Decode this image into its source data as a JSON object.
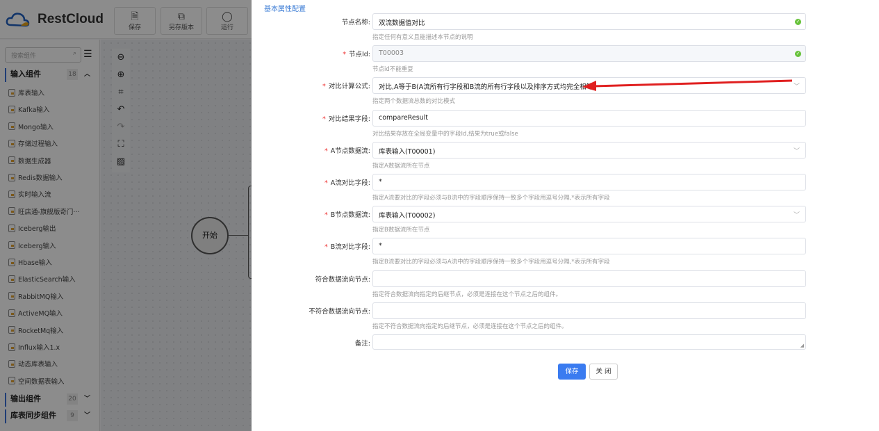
{
  "app": {
    "brand": "RestCloud",
    "toolbar": [
      {
        "label": "保存",
        "icon": "save-icon"
      },
      {
        "label": "另存版本",
        "icon": "save-version-icon"
      },
      {
        "label": "运行",
        "icon": "run-icon"
      }
    ]
  },
  "sidebar": {
    "search_placeholder": "搜索组件",
    "groups": [
      {
        "label": "输入组件",
        "count": "18",
        "expanded": true
      },
      {
        "label": "输出组件",
        "count": "20"
      },
      {
        "label": "库表同步组件",
        "count": "9"
      }
    ],
    "items": [
      "库表输入",
      "Kafka输入",
      "Mongo输入",
      "存储过程输入",
      "数据生成器",
      "Redis数据输入",
      "实时输入流",
      "旺店通-旗舰版奇门···",
      "Iceberg输出",
      "Iceberg输入",
      "Hbase输入",
      "ElasticSearch输入",
      "RabbitMQ输入",
      "ActiveMQ输入",
      "RocketMq输入",
      "Influx输入1.x",
      "动态库表输入",
      "空间数据表输入"
    ]
  },
  "canvas": {
    "start_node": "开始"
  },
  "form": {
    "section_title": "基本属性配置",
    "fields": [
      {
        "label": "节点名称:",
        "value": "双流数据值对比",
        "hint": "指定任何有意义且能描述本节点的说明",
        "required": false
      },
      {
        "label": "节点Id:",
        "value": "T00003",
        "hint": "节点id不能重复",
        "required": true
      },
      {
        "label": "对比计算公式:",
        "value": "对比,A等于B(A流所有行字段和B流的所有行字段以及排序方式均完全相等)",
        "hint": "指定两个数据流总数的对比模式",
        "required": true
      },
      {
        "label": "对比结果字段:",
        "value": "compareResult",
        "hint": "对比结果存放在全局变量中的字段Id,结果为true或false",
        "required": true
      },
      {
        "label": "A节点数据流:",
        "value": "库表输入(T00001)",
        "hint": "指定A数据流所在节点",
        "required": true
      },
      {
        "label": "A流对比字段:",
        "value": "*",
        "hint": "指定A流要对比的字段必须与B流中的字段顺序保持一致多个字段用逗号分隔,*表示所有字段",
        "required": true
      },
      {
        "label": "B节点数据流:",
        "value": "库表输入(T00002)",
        "hint": "指定B数据流所在节点",
        "required": true
      },
      {
        "label": "B流对比字段:",
        "value": "*",
        "hint": "指定B流要对比的字段必须与A流中的字段顺序保持一致多个字段用逗号分隔,*表示所有字段",
        "required": true
      },
      {
        "label": "符合数据流向节点:",
        "value": "",
        "hint": "指定符合数据流向指定的后继节点，必须是连接在这个节点之后的组件。",
        "required": false
      },
      {
        "label": "不符合数据流向节点:",
        "value": "",
        "hint": "指定不符合数据流向指定的后继节点，必须是连接在这个节点之后的组件。",
        "required": false
      },
      {
        "label": "备注:",
        "value": "",
        "required": false
      }
    ],
    "save_label": "保存",
    "close_label": "关 闭"
  },
  "colors": {
    "primary": "#3a7bf0",
    "required": "#e33333",
    "annotation_arrow": "#e02020"
  }
}
